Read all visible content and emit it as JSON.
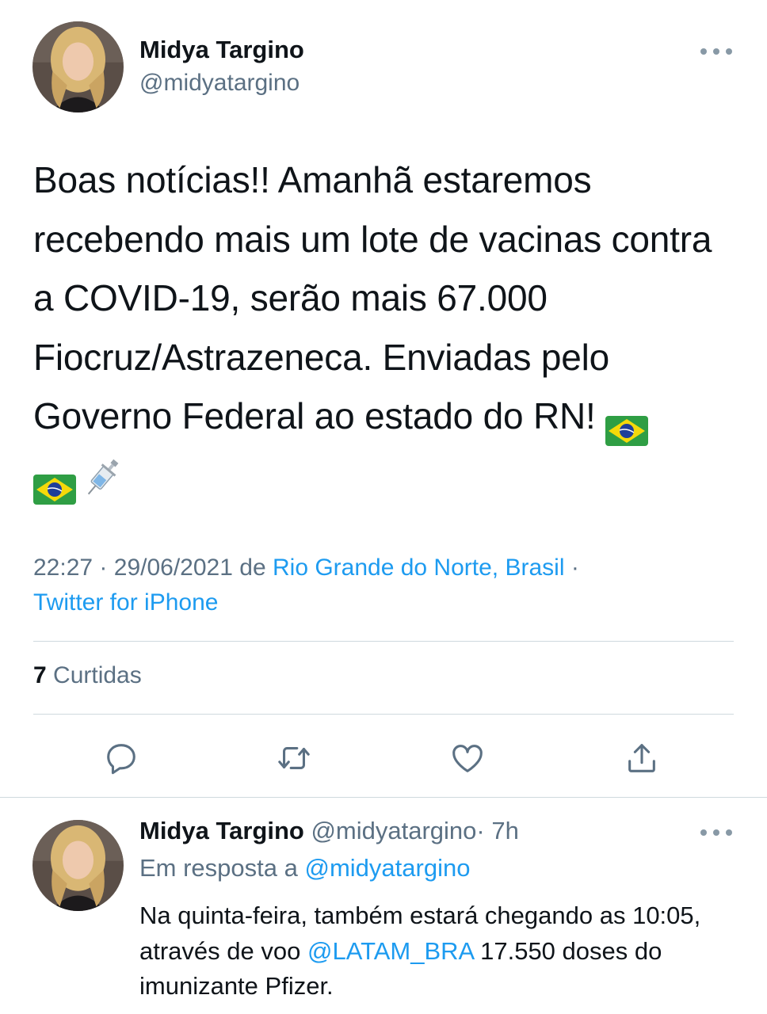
{
  "tweet": {
    "author_name": "Midya Targino",
    "author_handle": "@midyatargino",
    "text": "Boas notícias!! Amanhã estaremos recebendo mais um lote de vacinas contra a COVID-19, serão mais 67.000 Fiocruz/Astrazeneca. Enviadas pelo Governo Federal ao estado do RN!",
    "emojis": [
      "brazil-flag-icon",
      "brazil-flag-icon",
      "syringe-icon"
    ],
    "time": "22:27",
    "date": "29/06/2021",
    "from_word": "de",
    "location": "Rio Grande do Norte, Brasil",
    "separator": "·",
    "source": "Twitter for iPhone",
    "likes_count": "7",
    "likes_label": "Curtidas"
  },
  "actions": [
    "reply-icon",
    "retweet-icon",
    "like-icon",
    "share-icon"
  ],
  "reply": {
    "author_name": "Midya Targino",
    "author_handle": "@midyatargino",
    "age": "· 7h",
    "reply_prefix": "Em resposta a",
    "reply_to": "@midyatargino",
    "text_before": "Na quinta-feira, também estará chegando as 10:05, através de voo",
    "mention": "@LATAM_BRA",
    "text_after": "17.550 doses do imunizante Pfizer."
  },
  "colors": {
    "text": "#0f1419",
    "secondary": "#5b7083",
    "link": "#1d9bf0",
    "divider": "#cfd9de"
  }
}
